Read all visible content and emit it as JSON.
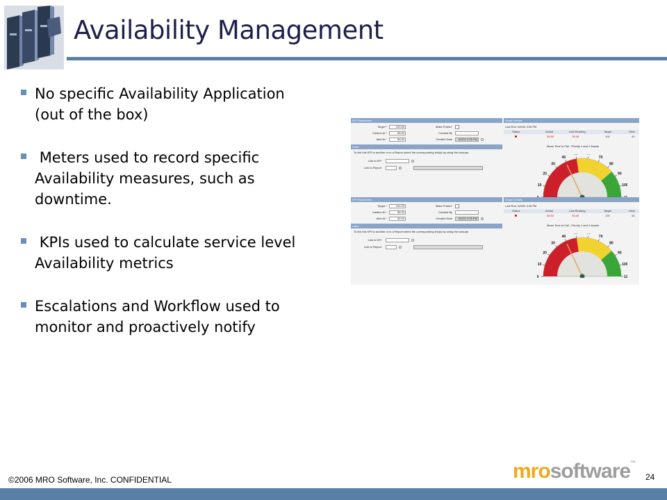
{
  "slide": {
    "title": "Availability Management",
    "bullets": [
      "No specific Availability Application (out of the box)",
      " Meters used to record specific Availability measures, such as downtime.",
      " KPIs used to calculate service level Availability metrics",
      "Escalations and Workflow used to monitor and proactively notify"
    ]
  },
  "screenshot": {
    "kpi_header": "KPI Parameters",
    "graph_header": "Graph Details",
    "links_header": "Links",
    "target_label": "Target *",
    "target_value": "100.00",
    "caution_label": "Caution At *",
    "caution_value": "85.00",
    "alert_label": "Alert At *",
    "alert_value": "50.00",
    "public_label": "Make Public?",
    "created_by_label": "Created By",
    "created_date_label": "Created Date",
    "created_date_value": "6/0/04 3:05 PM",
    "links_hint": "To link this KPI to another or to a Report select the corresponding link(s) by using the lookups.",
    "link_kpi_label": "Link to KPI",
    "link_report_label": "Link to Report",
    "last_run": "Last Run: 6/0/04 3:05 PM",
    "grid_headers": [
      "Status",
      "Actual",
      "Last Reading",
      "Target",
      "View"
    ],
    "grid_values": [
      "39.53",
      "76.45",
      "100",
      "40."
    ],
    "gauge_title": "Mean Time to Fail - Priority 1 and 2 Assets",
    "gauge_ticks": [
      "0",
      "10",
      "20",
      "30",
      "40",
      "50",
      "60",
      "70",
      "80",
      "90",
      "100",
      "110"
    ],
    "gauge_value": 39.53
  },
  "footer": {
    "copyright": "©2006 MRO Software, Inc.  CONFIDENTIAL",
    "brand_mro": "mro",
    "brand_software": "software",
    "brand_tm": "™",
    "page_number": "24"
  },
  "colors": {
    "title": "#1f1f4c",
    "rule": "#5a7fa6",
    "bullet": "#6a8fb6",
    "brand_orange": "#f0a81c",
    "brand_gray": "#9d9d9d",
    "gauge_red": "#cc1f2a",
    "gauge_yellow": "#f2d22e",
    "gauge_green": "#3aa639"
  }
}
